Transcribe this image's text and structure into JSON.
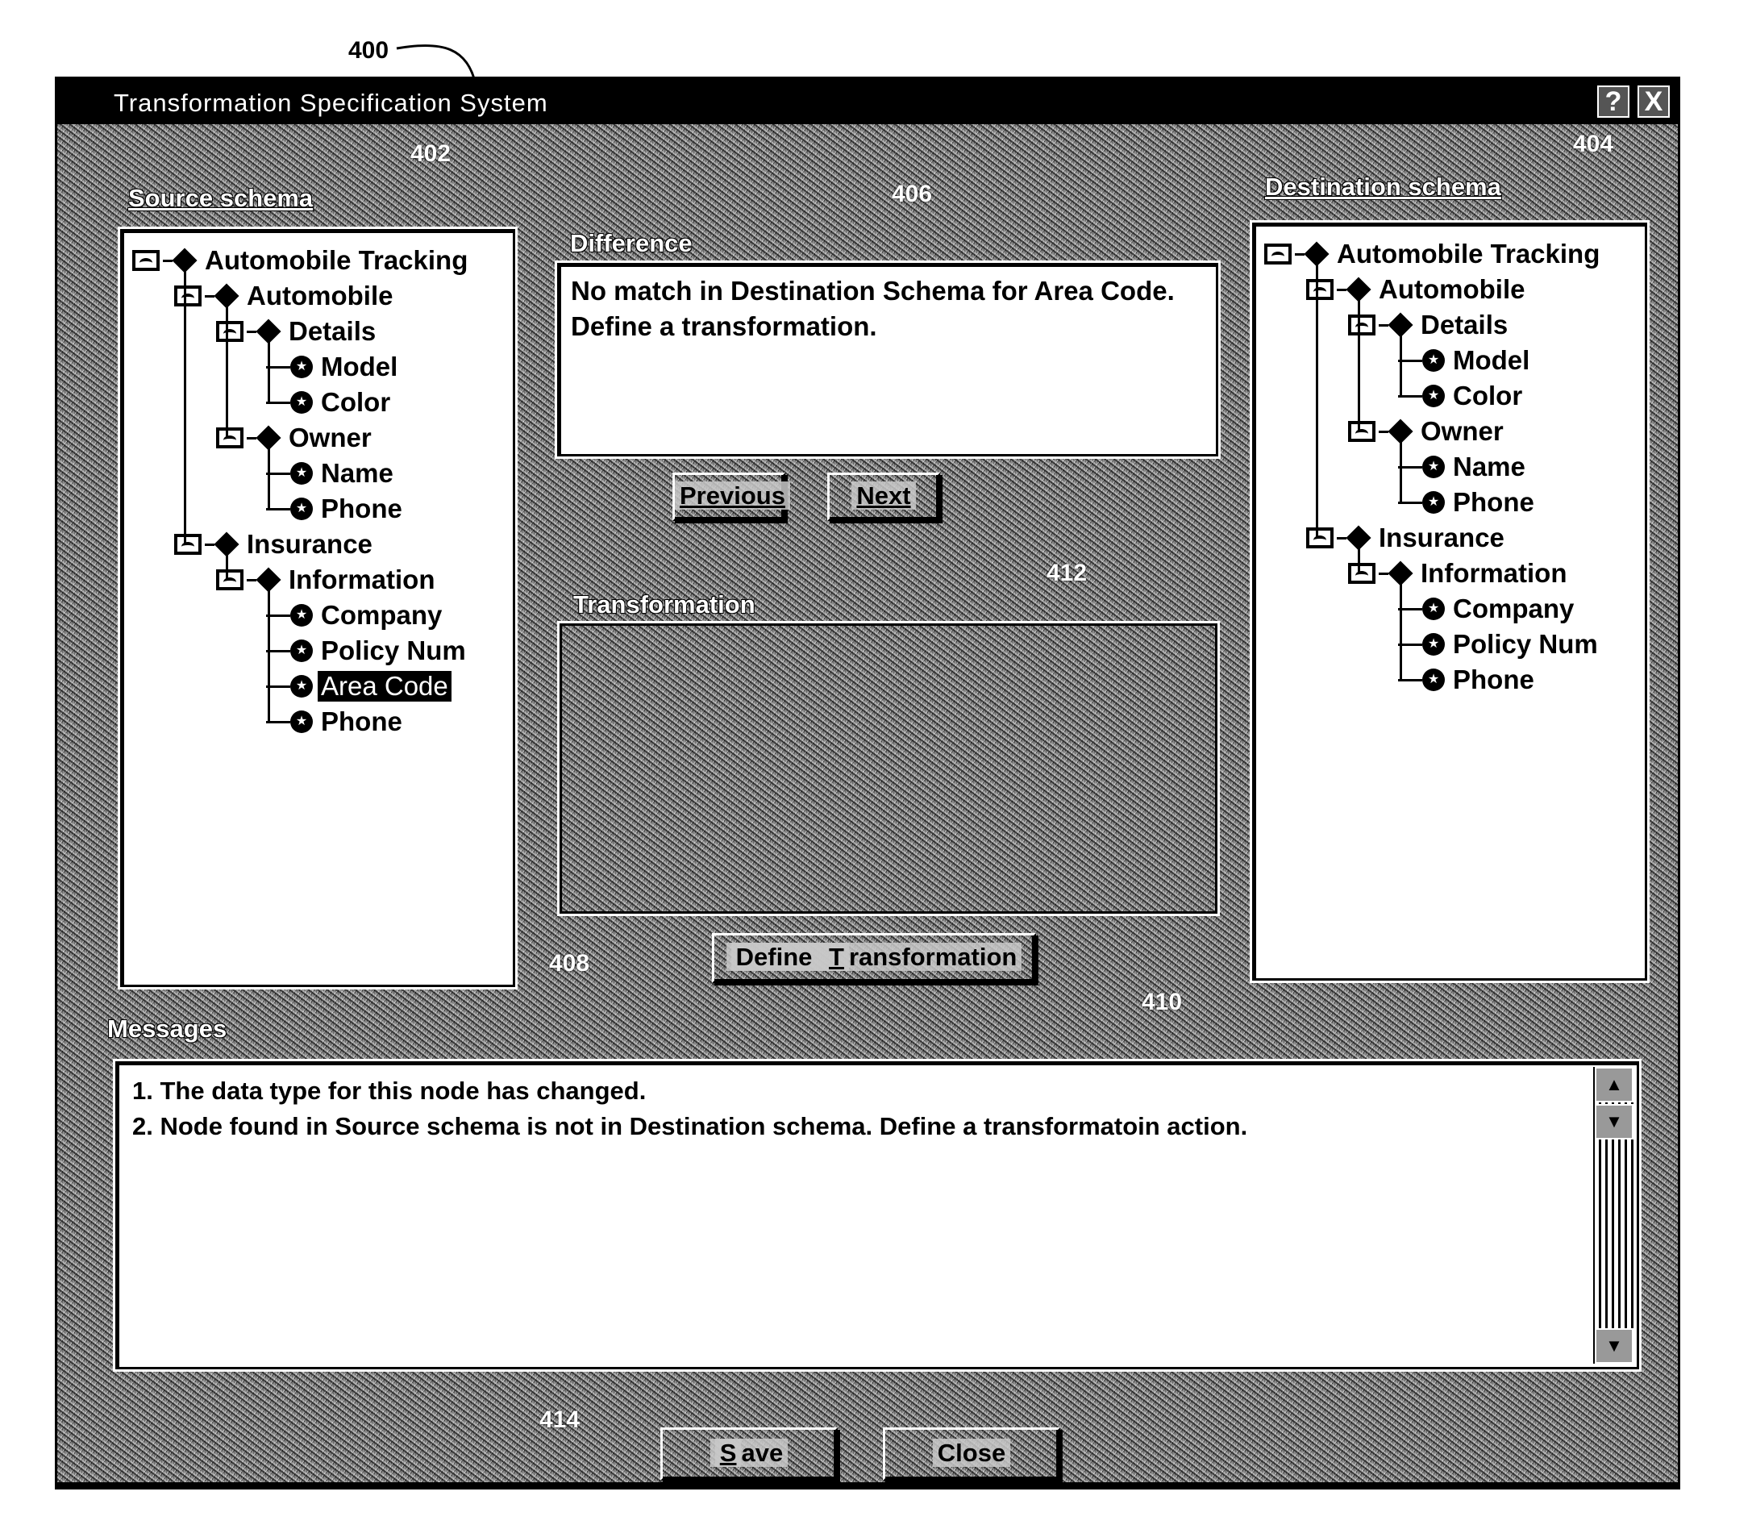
{
  "window": {
    "title": "Transformation Specification System",
    "help_glyph": "?",
    "close_glyph": "X"
  },
  "ref_labels": {
    "window": "400",
    "source": "402",
    "destination": "404",
    "difference": "406",
    "messages": "408",
    "define_button": "410",
    "transformation": "412",
    "save": "414"
  },
  "source_schema": {
    "label": "Source schema",
    "nodes": [
      {
        "label": "Automobile Tracking",
        "level": 0,
        "type": "group"
      },
      {
        "label": "Automobile",
        "level": 1,
        "type": "group"
      },
      {
        "label": "Details",
        "level": 2,
        "type": "group"
      },
      {
        "label": "Model",
        "level": 3,
        "type": "leaf"
      },
      {
        "label": "Color",
        "level": 3,
        "type": "leaf"
      },
      {
        "label": "Owner",
        "level": 2,
        "type": "group"
      },
      {
        "label": "Name",
        "level": 3,
        "type": "leaf"
      },
      {
        "label": "Phone",
        "level": 3,
        "type": "leaf"
      },
      {
        "label": "Insurance",
        "level": 1,
        "type": "group"
      },
      {
        "label": "Information",
        "level": 2,
        "type": "group"
      },
      {
        "label": "Company",
        "level": 3,
        "type": "leaf"
      },
      {
        "label": "Policy Num",
        "level": 3,
        "type": "leaf"
      },
      {
        "label": "Area Code",
        "level": 3,
        "type": "leaf",
        "selected": true
      },
      {
        "label": "Phone",
        "level": 3,
        "type": "leaf"
      }
    ]
  },
  "destination_schema": {
    "label": "Destination schema",
    "nodes": [
      {
        "label": "Automobile Tracking",
        "level": 0,
        "type": "group"
      },
      {
        "label": "Automobile",
        "level": 1,
        "type": "group"
      },
      {
        "label": "Details",
        "level": 2,
        "type": "group"
      },
      {
        "label": "Model",
        "level": 3,
        "type": "leaf"
      },
      {
        "label": "Color",
        "level": 3,
        "type": "leaf"
      },
      {
        "label": "Owner",
        "level": 2,
        "type": "group"
      },
      {
        "label": "Name",
        "level": 3,
        "type": "leaf"
      },
      {
        "label": "Phone",
        "level": 3,
        "type": "leaf"
      },
      {
        "label": "Insurance",
        "level": 1,
        "type": "group"
      },
      {
        "label": "Information",
        "level": 2,
        "type": "group"
      },
      {
        "label": "Company",
        "level": 3,
        "type": "leaf"
      },
      {
        "label": "Policy Num",
        "level": 3,
        "type": "leaf"
      },
      {
        "label": "Phone",
        "level": 3,
        "type": "leaf"
      }
    ]
  },
  "difference": {
    "label": "Difference",
    "text": "No match in Destination Schema for Area Code.  Define a transformation."
  },
  "navigation": {
    "previous_label": "Previous",
    "next_label": "Next"
  },
  "transformation": {
    "label": "Transformation",
    "define_button_label_prefix": "Define ",
    "define_button_label_underlined": "T",
    "define_button_label_rest": "ransformation"
  },
  "messages": {
    "label": "Messages",
    "items": [
      "1. The data type for this node has changed.",
      "2. Node found in Source schema is not in Destination schema.  Define a transformatoin action."
    ]
  },
  "footer": {
    "save_underlined": "S",
    "save_rest": "ave",
    "close_label": "Close"
  },
  "icons": {
    "expander": "collapse-box-icon",
    "group_node": "diamond-icon",
    "leaf_node": "star-circle-icon",
    "leaf_glyph": "★"
  }
}
